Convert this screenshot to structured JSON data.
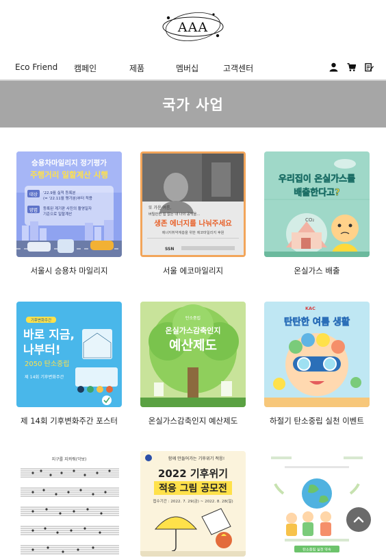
{
  "brand": {
    "logo_text": "AAA"
  },
  "nav": {
    "items": [
      "Eco Friend",
      "캠페인",
      "제품",
      "멤버십",
      "고객센터"
    ],
    "icons": [
      "user-icon",
      "cart-icon",
      "order-icon"
    ]
  },
  "banner": {
    "title": "국가 사업"
  },
  "cards": [
    {
      "caption": "서울시 승용차 마일리지",
      "poster": {
        "line1": "승용차마일리지 정기평가",
        "line2": "주행거리 일할계산 시행",
        "tag1": "대상",
        "text1a": "'22.9월 실적 등록분",
        "text1b": "(= '22.11월 평가분)부터 적용",
        "tag2": "방법",
        "text2a": "등록된 계기판 사진의 촬영일자",
        "text2b": "기준으로 일할계산"
      }
    },
    {
      "caption": "서울 에코마일리지",
      "poster": {
        "line1": "또 가운 여름,",
        "line2": "버틸만한 힘 없는 내 나의 공백을…",
        "line3": "생존 에너지를 나눠주세요",
        "line4": "에너지취약계층을 위한 에코마일리지 후원",
        "footer": "SSN"
      }
    },
    {
      "caption": "온실가스 배출",
      "poster": {
        "line1": "우리집이 온실가스를",
        "line2": "배출한다고?",
        "co2": "CO₂"
      }
    },
    {
      "caption": "제 14회 기후변화주간 포스터",
      "poster": {
        "badge": "기후변화주간",
        "line1": "바로 지금,",
        "line2": "나부터!",
        "line3": "2050 탄소중립",
        "line4": "제 14회 기후변화주간"
      }
    },
    {
      "caption": "온실가스감축인지 예산제도",
      "poster": {
        "line1": "탄소중립",
        "line2": "온실가스감축인지",
        "line3": "예산제도"
      }
    },
    {
      "caption": "하절기 탄소중립 실천 이벤트",
      "poster": {
        "badge": "KAC",
        "line1": "탄탄한 여름 생활"
      }
    },
    {
      "caption": "",
      "poster": {
        "title": "지구를 지켜줘(악보)"
      }
    },
    {
      "caption": "",
      "poster": {
        "line0": "함께 만들어가는 기후위기 적응!",
        "line1": "2022 기후위기",
        "line2": "적응 그림 공모전",
        "line3": "접수기간 : 2022. 7. 29(금) ~ 2022. 8. 28(일)"
      }
    },
    {
      "caption": "",
      "poster": {
        "footer": "탄소중립 실천 약속"
      }
    }
  ],
  "colors": {
    "banner": "#a6a6a6",
    "card1_bg": "#8fa3f0",
    "card2_bg": "#f2a55a",
    "card3_bg": "#9fd8c8",
    "card4_bg": "#49b7ea",
    "card5_bg": "#c8e39a",
    "card6_bg": "#bfe7f3",
    "accent_yellow": "#ffe14a"
  },
  "scroll_top": {
    "icon": "chevron-up-icon"
  }
}
